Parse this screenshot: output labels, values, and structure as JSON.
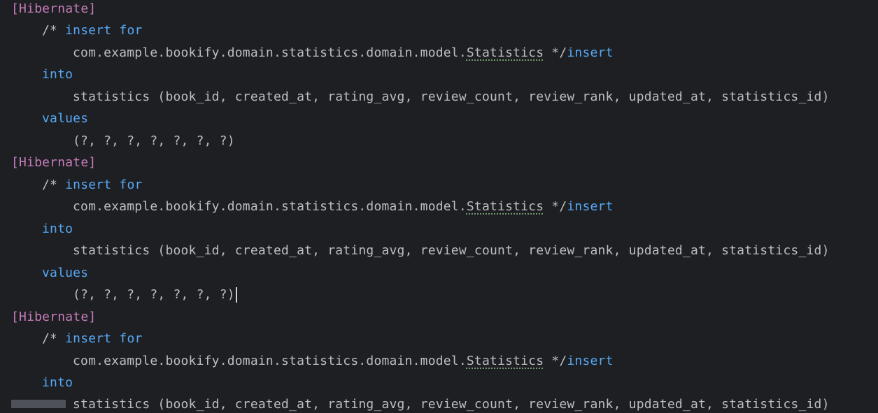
{
  "console": {
    "blocks": [
      {
        "tag": "[Hibernate]",
        "comment_open": "/* ",
        "insert_kw": "insert",
        "for_kw": "for",
        "entity_prefix": "com.example.bookify.domain.statistics.domain.model.",
        "entity_name": "Statistics",
        "comment_close": " */",
        "insert_kw2": "insert",
        "into_kw": "into",
        "columns": "statistics (book_id, created_at, rating_avg, review_count, review_rank, updated_at, statistics_id)",
        "values_kw": "values",
        "params": "(?, ?, ?, ?, ?, ?, ?)"
      },
      {
        "tag": "[Hibernate]",
        "comment_open": "/* ",
        "insert_kw": "insert",
        "for_kw": "for",
        "entity_prefix": "com.example.bookify.domain.statistics.domain.model.",
        "entity_name": "Statistics",
        "comment_close": " */",
        "insert_kw2": "insert",
        "into_kw": "into",
        "columns": "statistics (book_id, created_at, rating_avg, review_count, review_rank, updated_at, statistics_id)",
        "values_kw": "values",
        "params": "(?, ?, ?, ?, ?, ?, ?)"
      },
      {
        "tag": "[Hibernate]",
        "comment_open": "/* ",
        "insert_kw": "insert",
        "for_kw": "for",
        "entity_prefix": "com.example.bookify.domain.statistics.domain.model.",
        "entity_name": "Statistics",
        "comment_close": " */",
        "insert_kw2": "insert",
        "into_kw": "into",
        "columns": "statistics (book_id, created_at, rating_avg, review_count, review_rank, updated_at, statistics_id)"
      }
    ]
  }
}
